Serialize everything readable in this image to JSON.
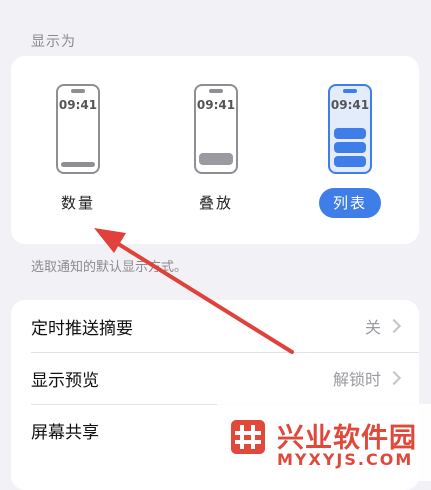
{
  "display_as": {
    "header": "显示为",
    "options": [
      {
        "label": "数量",
        "clock": "09:41",
        "selected": false
      },
      {
        "label": "叠放",
        "clock": "09:41",
        "selected": false
      },
      {
        "label": "列表",
        "clock": "09:41",
        "selected": true
      }
    ],
    "helper": "选取通知的默认显示方式。"
  },
  "settings": [
    {
      "label": "定时推送摘要",
      "value": "关"
    },
    {
      "label": "显示预览",
      "value": "解锁时"
    },
    {
      "label": "屏幕共享",
      "value": ""
    }
  ],
  "watermark": {
    "title": "兴业软件园",
    "subtitle": "MYXYJS.COM"
  },
  "colors": {
    "accent": "#3f7de8",
    "annotation_arrow": "#e0413a",
    "watermark": "#e0483a"
  }
}
